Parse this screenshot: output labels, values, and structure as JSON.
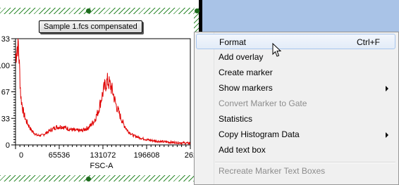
{
  "plot": {
    "title": "Sample 1.fcs compensated",
    "x_label": "FSC-A",
    "x_ticks": [
      "0",
      "65536",
      "131072",
      "196608",
      "2621"
    ],
    "y_ticks": [
      "33",
      "100",
      "67",
      "33",
      "0"
    ]
  },
  "chart_data": {
    "type": "line",
    "title": "Sample 1.fcs compensated",
    "xlabel": "FSC-A",
    "ylabel": "",
    "series": [
      {
        "color": "#e00000",
        "x": [
          0,
          4000,
          8000,
          12000,
          16000,
          24000,
          32000,
          40000,
          50000,
          60000,
          70000,
          80000,
          90000,
          100000,
          110000,
          118000,
          124000,
          130000,
          134000,
          138000,
          142000,
          146000,
          150000,
          156000,
          162000,
          168000,
          176000,
          186000,
          200000,
          220000,
          240000,
          262000
        ],
        "y": [
          110,
          130,
          60,
          40,
          30,
          18,
          12,
          12,
          17,
          22,
          23,
          20,
          18,
          18,
          22,
          30,
          42,
          62,
          74,
          80,
          75,
          66,
          52,
          38,
          26,
          18,
          12,
          9,
          6,
          4,
          3,
          2
        ]
      }
    ],
    "xlim": [
      0,
      262144
    ],
    "ylim": [
      0,
      133
    ],
    "grid": false
  },
  "menu": {
    "items": [
      {
        "label": "Format",
        "shortcut": "Ctrl+F",
        "submenu": false,
        "disabled": false,
        "highlighted": true
      },
      {
        "label": "Add overlay",
        "shortcut": "",
        "submenu": false,
        "disabled": false,
        "highlighted": false
      },
      {
        "label": "Create marker",
        "shortcut": "",
        "submenu": false,
        "disabled": false,
        "highlighted": false
      },
      {
        "label": "Show markers",
        "shortcut": "",
        "submenu": true,
        "disabled": false,
        "highlighted": false
      },
      {
        "label": "Convert Marker to Gate",
        "shortcut": "",
        "submenu": false,
        "disabled": true,
        "highlighted": false
      },
      {
        "label": "Statistics",
        "shortcut": "",
        "submenu": false,
        "disabled": false,
        "highlighted": false
      },
      {
        "label": "Copy Histogram Data",
        "shortcut": "",
        "submenu": true,
        "disabled": false,
        "highlighted": false
      },
      {
        "label": "Add text box",
        "shortcut": "",
        "submenu": false,
        "disabled": false,
        "highlighted": false
      },
      {
        "label": "Recreate Marker Text Boxes",
        "shortcut": "",
        "submenu": false,
        "disabled": true,
        "highlighted": false
      }
    ]
  }
}
